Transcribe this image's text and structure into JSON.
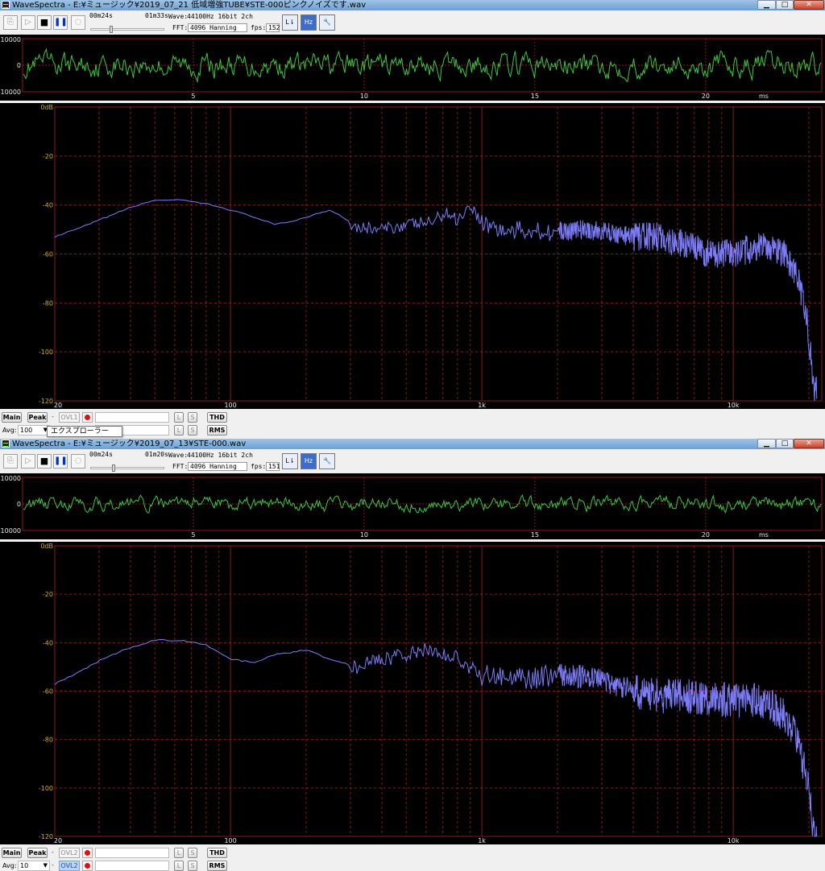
{
  "windows": [
    {
      "title": "WaveSpectra - E:¥ミュージック¥2019_07_21  低域増強TUBE¥STE-000ピンクノイズです.wav",
      "elapsed": "00m24s",
      "total": "01m33s",
      "wave_label": "Wave:",
      "wave_info": "44100Hz 16bit 2ch",
      "fft_label": "FFT:",
      "fft_info": "4096 Hanning",
      "fps_label": "fps:",
      "fps": "152",
      "position_fraction": 0.26,
      "waveform": {
        "y_ticks": [
          "10000",
          "0",
          "-10000"
        ],
        "x_ticks": [
          "5",
          "10",
          "15",
          "20"
        ],
        "x_unit": "ms",
        "amplitude_scale": 0.3
      },
      "spectrum": {
        "y_ticks": [
          "0dB",
          "-20",
          "-40",
          "-60",
          "-80",
          "-100",
          "-120"
        ],
        "x_ticks": [
          "20",
          "100",
          "1k",
          "10k"
        ],
        "curve": [
          [
            20,
            -53
          ],
          [
            25,
            -49.5
          ],
          [
            32,
            -45
          ],
          [
            40,
            -41
          ],
          [
            50,
            -38
          ],
          [
            63,
            -38
          ],
          [
            80,
            -39.5
          ],
          [
            100,
            -42
          ],
          [
            125,
            -45
          ],
          [
            150,
            -48
          ],
          [
            170,
            -47
          ],
          [
            200,
            -45
          ],
          [
            230,
            -43
          ],
          [
            250,
            -42
          ],
          [
            280,
            -45
          ],
          [
            320,
            -49
          ],
          [
            400,
            -50
          ],
          [
            500,
            -48
          ],
          [
            630,
            -47
          ],
          [
            720,
            -43
          ],
          [
            800,
            -46
          ],
          [
            900,
            -40
          ],
          [
            1000,
            -47
          ],
          [
            1250,
            -51
          ],
          [
            1600,
            -50
          ],
          [
            2000,
            -51
          ],
          [
            2500,
            -50
          ],
          [
            3150,
            -51
          ],
          [
            4000,
            -53
          ],
          [
            5000,
            -53
          ],
          [
            6300,
            -56
          ],
          [
            8000,
            -60
          ],
          [
            10000,
            -60
          ],
          [
            12500,
            -57
          ],
          [
            14000,
            -57
          ],
          [
            16000,
            -60
          ],
          [
            18000,
            -70
          ],
          [
            19500,
            -84
          ],
          [
            21000,
            -115
          ]
        ],
        "noise_amp": 5
      },
      "controls": {
        "main": "Main",
        "peak": "Peak",
        "ovl": "OVL1",
        "avg_label": "Avg:",
        "avg": "100",
        "l": "L",
        "s": "S",
        "thd": "THD",
        "rms": "RMS",
        "ovl_active": false
      }
    },
    {
      "title": "WaveSpectra - E:¥ミュージック¥2019_07_13¥STE-000.wav",
      "elapsed": "00m24s",
      "total": "01m20s",
      "wave_label": "Wave:",
      "wave_info": "44100Hz 16bit 2ch",
      "fft_label": "FFT:",
      "fft_info": "4096 Hanning",
      "fps_label": "fps:",
      "fps": "151",
      "position_fraction": 0.3,
      "waveform": {
        "y_ticks": [
          "10000",
          "0",
          "-10000"
        ],
        "x_ticks": [
          "5",
          "10",
          "15",
          "20"
        ],
        "x_unit": "ms",
        "amplitude_scale": 0.18
      },
      "spectrum": {
        "y_ticks": [
          "0dB",
          "-20",
          "-40",
          "-60",
          "-80",
          "-100",
          "-120"
        ],
        "x_ticks": [
          "20",
          "100",
          "1k",
          "10k"
        ],
        "curve": [
          [
            20,
            -57
          ],
          [
            25,
            -52
          ],
          [
            32,
            -46
          ],
          [
            40,
            -42
          ],
          [
            50,
            -39
          ],
          [
            63,
            -39
          ],
          [
            80,
            -41
          ],
          [
            100,
            -47
          ],
          [
            125,
            -48
          ],
          [
            150,
            -45
          ],
          [
            200,
            -43
          ],
          [
            250,
            -47
          ],
          [
            320,
            -50
          ],
          [
            400,
            -47
          ],
          [
            500,
            -45
          ],
          [
            600,
            -43
          ],
          [
            700,
            -45
          ],
          [
            800,
            -46
          ],
          [
            1000,
            -54
          ],
          [
            1250,
            -54
          ],
          [
            1600,
            -55
          ],
          [
            2000,
            -53
          ],
          [
            2500,
            -54
          ],
          [
            3150,
            -56
          ],
          [
            4000,
            -60
          ],
          [
            5000,
            -62
          ],
          [
            6300,
            -62
          ],
          [
            8000,
            -63
          ],
          [
            10000,
            -64
          ],
          [
            12500,
            -64
          ],
          [
            14000,
            -66
          ],
          [
            16000,
            -70
          ],
          [
            18000,
            -80
          ],
          [
            20000,
            -100
          ],
          [
            21000,
            -120
          ]
        ],
        "noise_amp": 6
      },
      "controls": {
        "main": "Main",
        "peak": "Peak",
        "ovl": "OVL2",
        "avg_label": "Avg:",
        "avg": "10",
        "l": "L",
        "s": "S",
        "thd": "THD",
        "rms": "RMS",
        "ovl_active": true
      }
    }
  ],
  "tooltip": "エクスプローラー",
  "colors": {
    "waveform": "#3cc83c",
    "spectrum": "#7c7cf8",
    "grid": "#8a1a1a",
    "axis_label": "#d8b000",
    "axis_label_wave": "#e8e8e8"
  }
}
